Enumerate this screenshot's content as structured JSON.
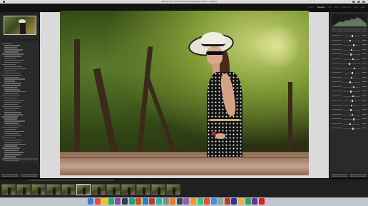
{
  "window": {
    "title": "catalog.lrcat - Adobe Photoshop Lightroom Classic - Develop"
  },
  "identity": {
    "brand": "Lightroom Classic"
  },
  "modules": [
    {
      "label": "Library",
      "active": false
    },
    {
      "label": "Develop",
      "active": true
    },
    {
      "label": "Map",
      "active": false
    },
    {
      "label": "Book",
      "active": false
    },
    {
      "label": "Slideshow",
      "active": false
    },
    {
      "label": "Print",
      "active": false
    },
    {
      "label": "Web",
      "active": false
    }
  ],
  "left_panel": {
    "navigator": "Navigator",
    "buttons": [
      "Copy...",
      "Paste"
    ]
  },
  "right_panel": {
    "buttons": [
      "Previous",
      "Reset"
    ]
  },
  "photo": {
    "subject": "woman in sun hat"
  },
  "colors": {
    "active_module": "#e6e6e6",
    "panel_bg": "#2a2a2a",
    "canvas_bg": "#dadada",
    "accent_strap": "#b8203a"
  }
}
